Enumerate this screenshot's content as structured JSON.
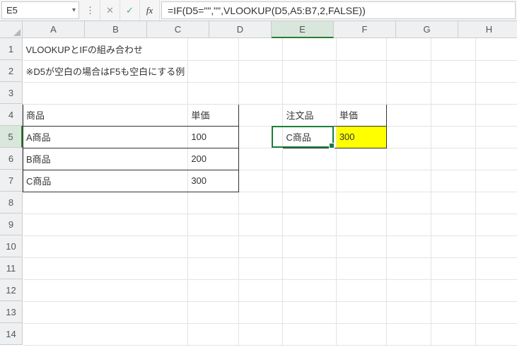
{
  "name_box": "E5",
  "formula": "=IF(D5=\"\",\"\",VLOOKUP(D5,A5:B7,2,FALSE))",
  "columns": [
    "A",
    "B",
    "C",
    "D",
    "E",
    "F",
    "G",
    "H"
  ],
  "active_col_index": 4,
  "rows": [
    "1",
    "2",
    "3",
    "4",
    "5",
    "6",
    "7",
    "8",
    "9",
    "10",
    "11",
    "12",
    "13",
    "14"
  ],
  "active_row_index": 4,
  "cells": {
    "A1": "VLOOKUPとIFの組み合わせ",
    "A2": "※D5が空白の場合はF5も空白にする例",
    "A4": "商品",
    "B4": "単価",
    "A5": "A商品",
    "B5": "100",
    "A6": "B商品",
    "B6": "200",
    "A7": "C商品",
    "B7": "300",
    "D4": "注文品",
    "E4": "単価",
    "D5": "C商品",
    "E5": "300"
  },
  "icons": {
    "dropdown": "▾",
    "ellipsis": "⋮",
    "cancel": "✕",
    "confirm": "✓",
    "fx": "fx"
  }
}
